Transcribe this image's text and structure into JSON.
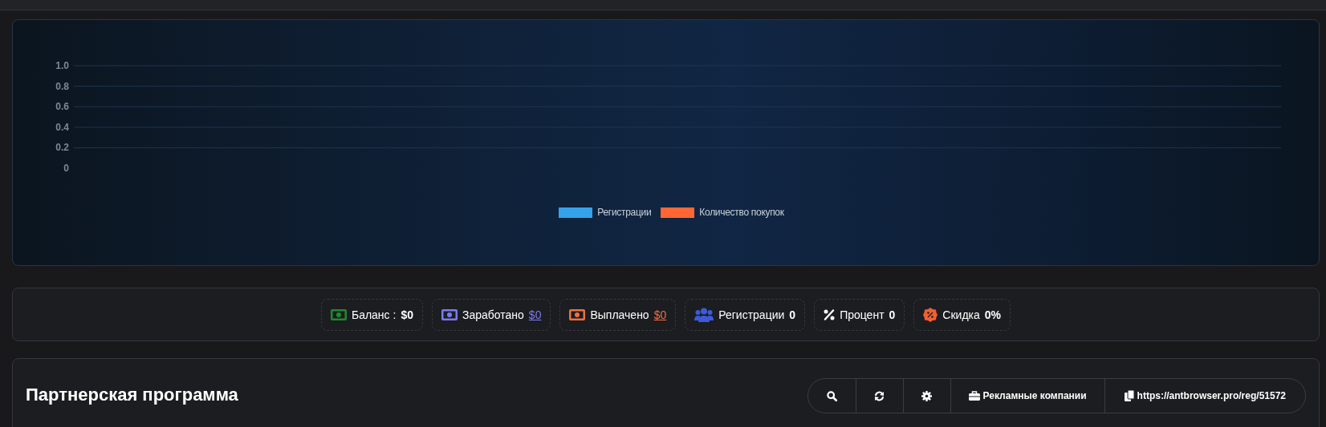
{
  "chart_data": {
    "type": "line",
    "grid": true,
    "ylim": [
      0,
      1
    ],
    "yticks": [
      0,
      0.2,
      0.4,
      0.6,
      0.8,
      {
        "value": 1,
        "label": "1.0"
      }
    ],
    "series": [
      {
        "name": "Регистрации",
        "color": "#36a2eb"
      },
      {
        "name": "Количество покупок",
        "color": "#ff6633"
      }
    ]
  },
  "stats": [
    {
      "kind": "money",
      "color": "#1e8a2e",
      "label": "Баланс :",
      "value": "$0",
      "link": false
    },
    {
      "kind": "money",
      "color": "#7b7bf0",
      "label": "Заработано",
      "value": "$0",
      "link": true
    },
    {
      "kind": "money",
      "color": "#f07040",
      "label": "Выплачено",
      "value": "$0",
      "link": true
    },
    {
      "kind": "users",
      "color": "#3b5bdb",
      "label": "Регистрации",
      "value": "0",
      "link": false
    },
    {
      "kind": "percent",
      "color": "#ffffff",
      "label": "Процент",
      "value": "0",
      "link": false
    },
    {
      "kind": "discount",
      "color": "#f06030",
      "label": "Скидка",
      "value": "0%",
      "link": false
    }
  ],
  "section": {
    "title": "Партнерская программа"
  },
  "toolbar": [
    {
      "kind": "search"
    },
    {
      "kind": "refresh"
    },
    {
      "kind": "settings"
    },
    {
      "kind": "briefcase",
      "label": "Рекламные компании"
    },
    {
      "kind": "copy",
      "label": "https://antbrowser.pro/reg/51572"
    }
  ]
}
